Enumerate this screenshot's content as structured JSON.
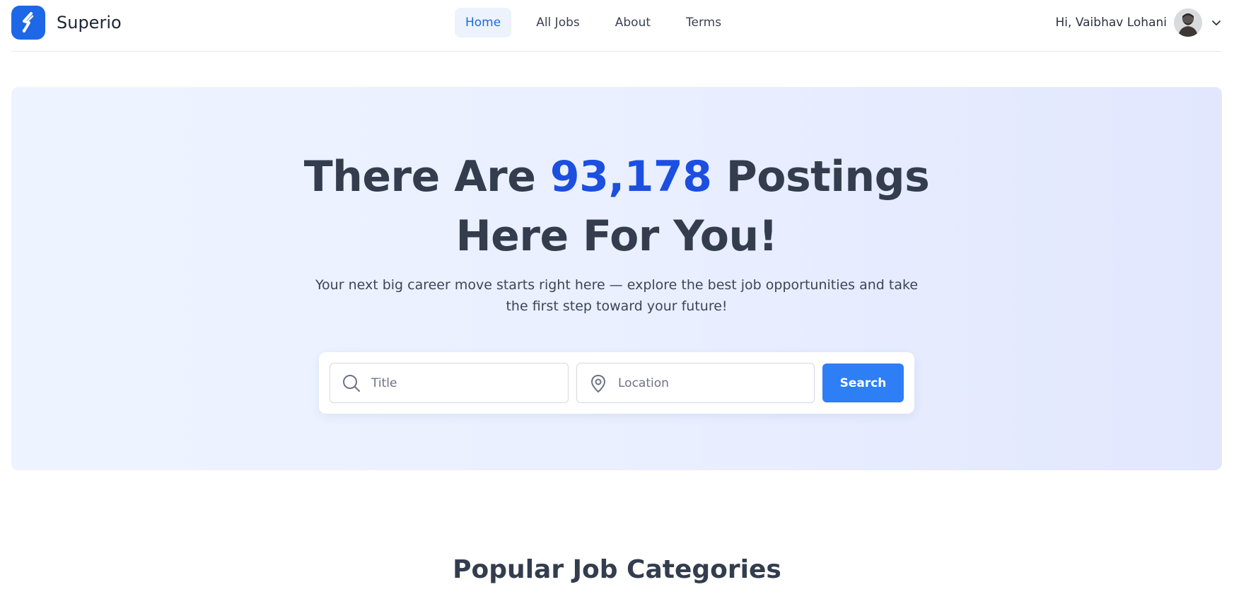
{
  "brand": {
    "name": "Superio",
    "logo_icon": "superio-logo-icon",
    "accent": "#1e67e6"
  },
  "nav": {
    "items": [
      {
        "label": "Home",
        "active": true
      },
      {
        "label": "All Jobs",
        "active": false
      },
      {
        "label": "About",
        "active": false
      },
      {
        "label": "Terms",
        "active": false
      }
    ]
  },
  "user": {
    "greeting": "Hi, Vaibhav Lohani",
    "menu_icon": "chevron-down-icon"
  },
  "hero": {
    "title_prefix": "There Are ",
    "count": "93,178",
    "title_suffix": " Postings",
    "title_line2": "Here For You!",
    "subtitle": "Your next big career move starts right here — explore the best job opportunities and take the first step toward your future!"
  },
  "search": {
    "title_placeholder": "Title",
    "title_value": "",
    "location_placeholder": "Location",
    "location_value": "",
    "button_label": "Search",
    "button_color": "#2e7ef5"
  },
  "sections": {
    "popular_title": "Popular Job Categories"
  }
}
